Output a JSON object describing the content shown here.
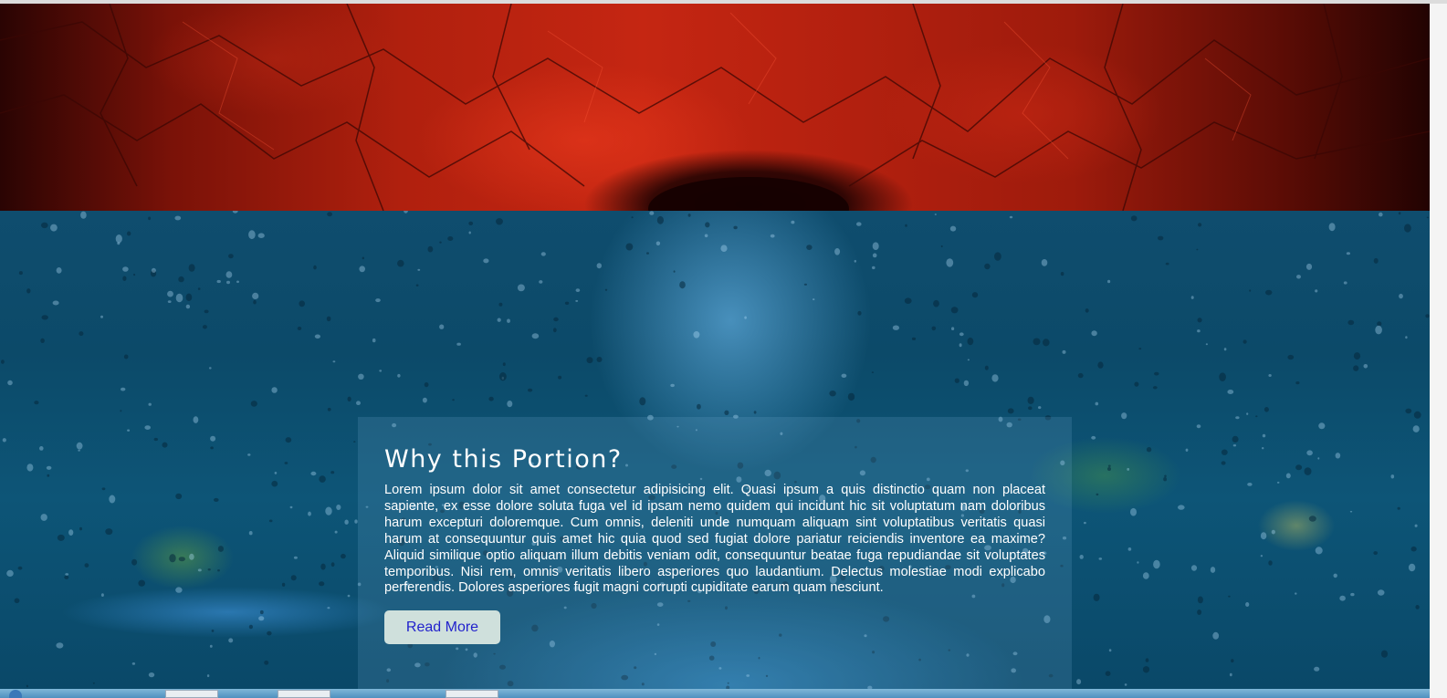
{
  "hero": {
    "description_icon": "red-rock-texture-banner"
  },
  "section": {
    "title": "Why this Portion?",
    "body": "Lorem ipsum dolor sit amet consectetur adipisicing elit. Quasi ipsum a quis distinctio quam non placeat sapiente, ex esse dolore soluta fuga vel id ipsam nemo quidem qui incidunt hic sit voluptatum nam doloribus harum excepturi doloremque. Cum omnis, deleniti unde numquam aliquam sint voluptatibus veritatis quasi harum at consequuntur quis amet hic quia quod sed fugiat dolore pariatur reiciendis inventore ea maxime? Aliquid similique optio aliquam illum debitis veniam odit, consequuntur beatae fuga repudiandae sit voluptates temporibus. Nisi rem, omnis veritatis libero asperiores quo laudantium. Delectus molestiae modi explicabo perferendis. Dolores asperiores fugit magni corrupti cupiditate earum quam nesciunt.",
    "button_label": "Read More"
  },
  "colors": {
    "hero_red": "#c52612",
    "section_blue": "#0c4a69",
    "button_bg": "#cfe0dc",
    "button_text": "#2222cc"
  }
}
